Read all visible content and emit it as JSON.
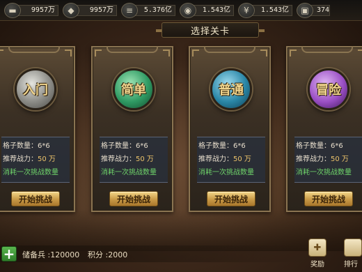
{
  "resources": [
    {
      "icon": "silver-ingot-icon",
      "value": "9957万"
    },
    {
      "icon": "food-sack-icon",
      "value": "9957万"
    },
    {
      "icon": "ore-stack-icon",
      "value": "5.376亿"
    },
    {
      "icon": "coin-icon",
      "value": "1.543亿"
    },
    {
      "icon": "wheat-icon",
      "value": "1.543亿"
    },
    {
      "icon": "cloth-icon",
      "value": "374"
    }
  ],
  "title": "选择关卡",
  "cards": [
    {
      "name": "入门",
      "orb_color": "#b9b9b4",
      "grid_label": "格子数量：",
      "grid_value": "6*6",
      "power_label": "推荐战力：",
      "power_value": "50 万",
      "cost_text": "消耗一次挑战数量",
      "button": "开始挑战"
    },
    {
      "name": "简单",
      "orb_color": "#2f9a63",
      "grid_label": "格子数量：",
      "grid_value": "6*6",
      "power_label": "推荐战力：",
      "power_value": "50 万",
      "cost_text": "消耗一次挑战数量",
      "button": "开始挑战"
    },
    {
      "name": "普通",
      "orb_color": "#2a86a6",
      "grid_label": "格子数量：",
      "grid_value": "6*6",
      "power_label": "推荐战力：",
      "power_value": "50 万",
      "cost_text": "消耗一次挑战数量",
      "button": "开始挑战"
    },
    {
      "name": "冒险",
      "orb_color": "#9a4fc4",
      "grid_label": "格子数量：",
      "grid_value": "6*6",
      "power_label": "推荐战力：",
      "power_value": "50 万",
      "cost_text": "消耗一次挑战数量",
      "button": "开始挑战"
    }
  ],
  "bottom": {
    "add_icon": "plus-icon",
    "reserve": "储备兵 :120000",
    "score": "积分 :2000",
    "reward_label": "奖励",
    "rank_label": "排行"
  }
}
